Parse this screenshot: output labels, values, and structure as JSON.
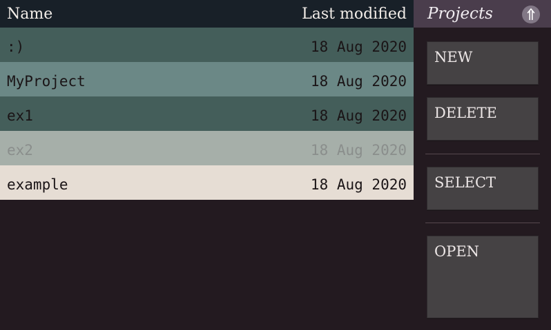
{
  "list": {
    "columns": {
      "name": "Name",
      "modified": "Last modified"
    },
    "rows": [
      {
        "name": ":)",
        "modified": "18 Aug 2020",
        "bg": "#445e5a",
        "state": "normal"
      },
      {
        "name": "MyProject",
        "modified": "18 Aug 2020",
        "bg": "#6b8886",
        "state": "normal"
      },
      {
        "name": "ex1",
        "modified": "18 Aug 2020",
        "bg": "#445e5a",
        "state": "normal"
      },
      {
        "name": "ex2",
        "modified": "18 Aug 2020",
        "bg": "#a6afa9",
        "state": "disabled"
      },
      {
        "name": "example",
        "modified": "18 Aug 2020",
        "bg": "#e6ddd4",
        "state": "normal"
      }
    ]
  },
  "projects": {
    "title": "Projects",
    "up_icon": "arrow-up-double-icon",
    "buttons": {
      "new": "NEW",
      "delete": "DELETE",
      "select": "SELECT",
      "open": "OPEN"
    }
  },
  "colors": {
    "background": "#231a20",
    "header_bg": "#182028",
    "projects_header_bg": "#4a3d4c",
    "button_bg": "#454244"
  }
}
